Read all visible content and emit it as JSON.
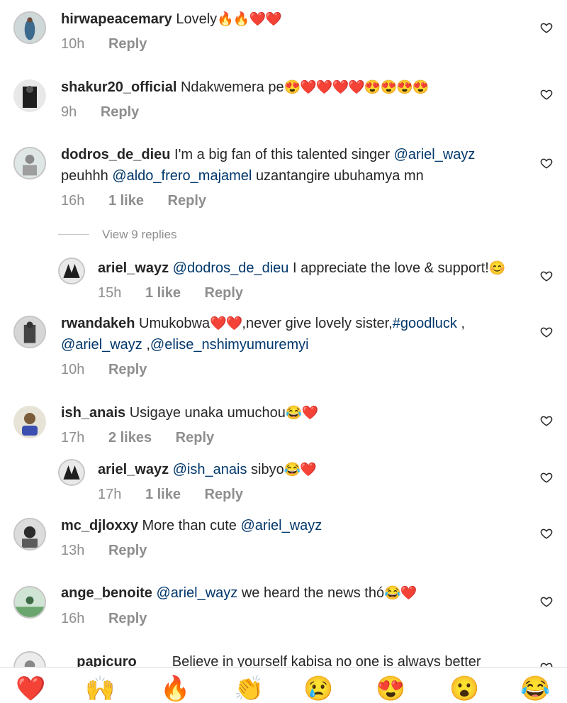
{
  "comments": [
    {
      "user": "hirwapeacemary",
      "text": "Lovely",
      "emoji": "🔥🔥❤️❤️",
      "time": "10h",
      "reply": "Reply"
    },
    {
      "user": "shakur20_official",
      "text": "Ndakwemera pe",
      "emoji": "😍❤️❤️❤️❤️😍😍😍😍",
      "time": "9h",
      "reply": "Reply"
    },
    {
      "user": "dodros_de_dieu",
      "text": "I'm a big fan of this talented singer",
      "mention1": "@ariel_wayz",
      "line2_pre": "peuhhh",
      "mention2": "@aldo_frero_majamel",
      "line2_post": "uzantangire ubuhamya mn",
      "time": "16h",
      "likes": "1 like",
      "reply": "Reply",
      "view_replies": "View 9 replies"
    },
    {
      "user": "ariel_wayz",
      "mention": "@dodros_de_dieu",
      "text": "I appreciate the love & support!",
      "emoji": "😊",
      "time": "15h",
      "likes": "1 like",
      "reply": "Reply"
    },
    {
      "user": "rwandakeh",
      "text": "Umukobwa",
      "emoji": "❤️❤️",
      "text2": ",never give lovely sister,",
      "hashtag": "#goodluck",
      "text3": ",",
      "mention1": "@ariel_wayz",
      "sep": ",",
      "mention2": "@elise_nshimyumuremyi",
      "time": "10h",
      "reply": "Reply"
    },
    {
      "user": "ish_anais",
      "text": "Usigaye unaka umuchou",
      "emoji": "😂❤️",
      "time": "17h",
      "likes": "2 likes",
      "reply": "Reply"
    },
    {
      "user": "ariel_wayz",
      "mention": "@ish_anais",
      "text": "sibyo",
      "emoji": "😂❤️",
      "time": "17h",
      "likes": "1 like",
      "reply": "Reply"
    },
    {
      "user": "mc_djloxxy",
      "text": "More than cute",
      "mention": "@ariel_wayz",
      "time": "13h",
      "reply": "Reply"
    },
    {
      "user": "ange_benoite",
      "mention": "@ariel_wayz",
      "text": "we heard the news thó",
      "emoji": "😂❤️",
      "time": "16h",
      "reply": "Reply"
    },
    {
      "user": "__papicuro____",
      "text": "Believe in yourself kabisa no one is always better"
    }
  ],
  "reactions": [
    "❤️",
    "🙌",
    "🔥",
    "👏",
    "😢",
    "😍",
    "😮",
    "😂"
  ],
  "icons": {
    "like": "heart-outline-icon"
  },
  "colors": {
    "mention": "#00376b",
    "meta": "#8e8e8e",
    "text": "#262626"
  }
}
